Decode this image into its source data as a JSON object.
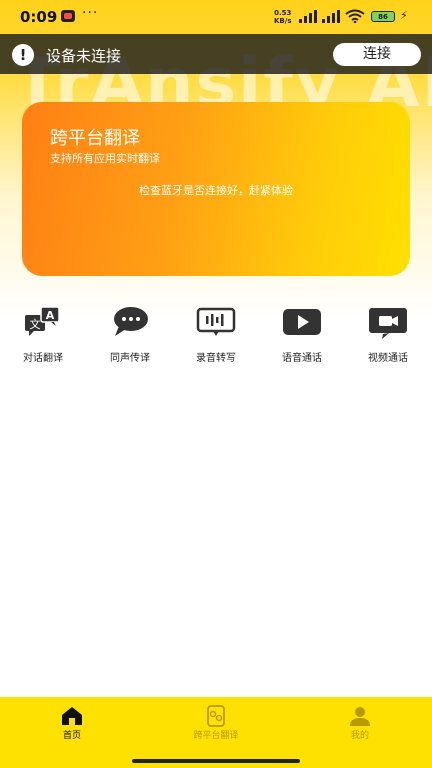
{
  "status_bar": {
    "time": "0:09",
    "speed_top": "0.53",
    "speed_bottom": "KB/s",
    "battery": "86"
  },
  "watermark": "TrAnsify AI",
  "banner": {
    "message": "设备未连接",
    "connect_label": "连接"
  },
  "card": {
    "title": "跨平台翻译",
    "subtitle": "支持所有应用实时翻译",
    "hint": "检查蓝牙是否连接好，赶紧体验"
  },
  "features": [
    {
      "label": "对话翻译",
      "icon": "conversation-translate-icon"
    },
    {
      "label": "同声传译",
      "icon": "chat-bubble-icon"
    },
    {
      "label": "录音转写",
      "icon": "recording-icon"
    },
    {
      "label": "语音通话",
      "icon": "play-icon"
    },
    {
      "label": "视频通话",
      "icon": "video-camera-icon"
    }
  ],
  "tabs": [
    {
      "label": "首页",
      "icon": "home-icon",
      "active": true
    },
    {
      "label": "跨平台翻译",
      "icon": "translate-device-icon",
      "active": false
    },
    {
      "label": "我的",
      "icon": "user-icon",
      "active": false
    }
  ],
  "colors": {
    "accent_yellow": "#ffe100",
    "card_orange": "#ff7f14",
    "icon_dark": "#333333",
    "inactive_tab": "#b59a00"
  }
}
